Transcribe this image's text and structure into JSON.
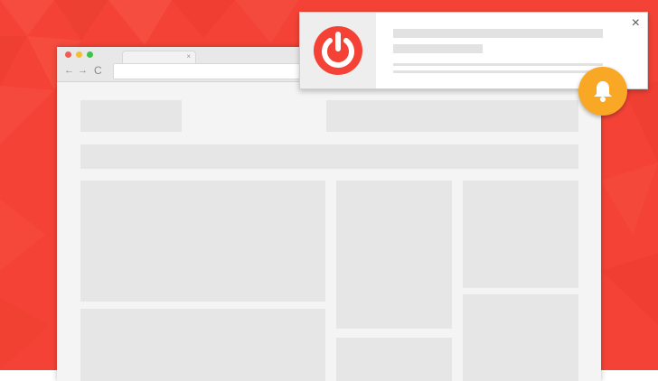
{
  "browser": {
    "tab_close": "×",
    "nav": {
      "back": "←",
      "forward": "→",
      "reload": "C"
    }
  },
  "notification": {
    "close": "×",
    "icon": "power-icon"
  },
  "colors": {
    "background": "#f44336",
    "power_icon": "#f44336",
    "bell_badge": "#f9a825"
  }
}
